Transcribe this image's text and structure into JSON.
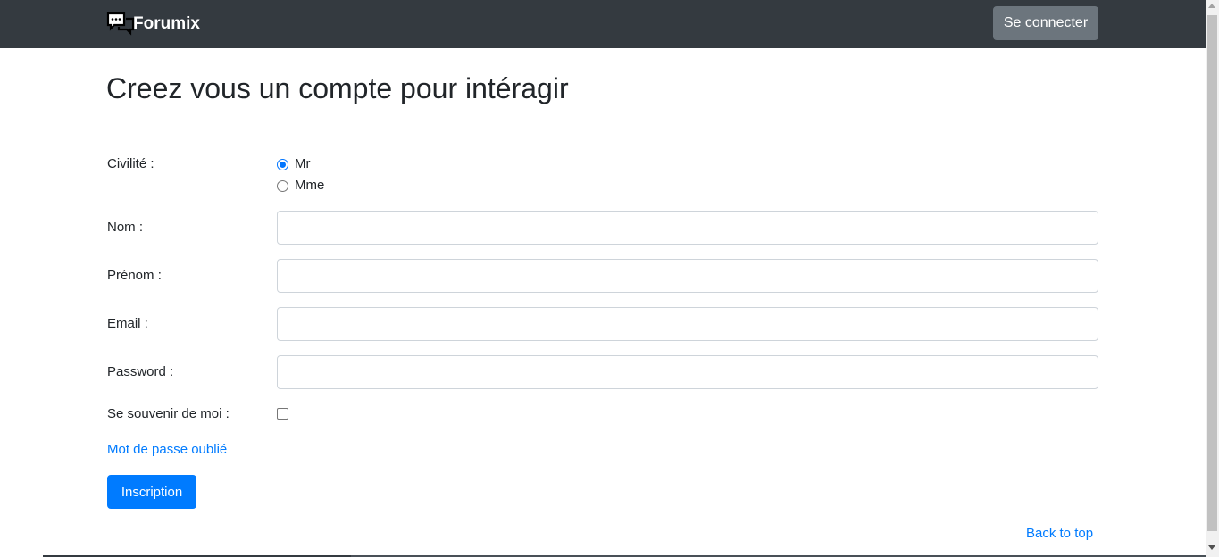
{
  "navbar": {
    "brand": "Forumix",
    "brand_icon": "chat-bubbles-icon",
    "login_label": "Se connecter",
    "background": "#343a40"
  },
  "page": {
    "title": "Creez vous un compte pour intéragir"
  },
  "form": {
    "civilite_label": "Civilité :",
    "civilite_options": [
      {
        "label": "Mr",
        "checked": true
      },
      {
        "label": "Mme",
        "checked": false
      }
    ],
    "nom_label": "Nom :",
    "nom_value": "",
    "prenom_label": "Prénom :",
    "prenom_value": "",
    "email_label": "Email :",
    "email_value": "",
    "password_label": "Password :",
    "password_value": "",
    "remember_label": "Se souvenir de moi :",
    "remember_checked": false,
    "forgot_link": "Mot de passe oublié",
    "submit_label": "Inscription"
  },
  "footer": {
    "back_to_top": "Back to top"
  },
  "colors": {
    "primary": "#007bff",
    "secondary": "#6c757d",
    "dark": "#343a40"
  }
}
